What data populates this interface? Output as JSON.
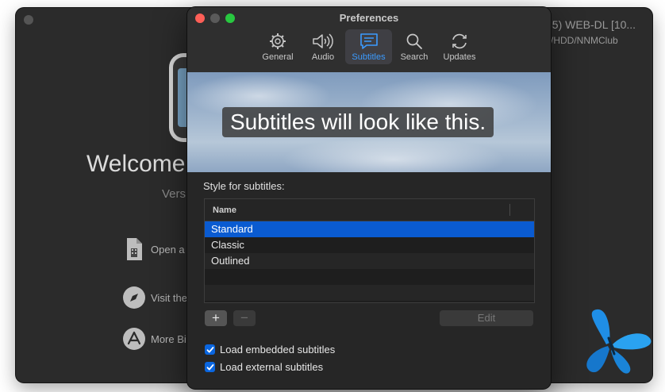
{
  "background_window": {
    "welcome_title": "Welcome",
    "version_label": "Vers",
    "items": [
      {
        "icon": "document-icon",
        "label": "Open a"
      },
      {
        "icon": "compass-icon",
        "label": "Visit the"
      },
      {
        "icon": "app-store-icon",
        "label": "More Bi"
      }
    ],
    "recent": {
      "line1": "35) WEB-DL [10...",
      "line2": "s/HDD/NNMClub"
    }
  },
  "preferences": {
    "title": "Preferences",
    "tabs": [
      {
        "icon": "gear-icon",
        "label": "General"
      },
      {
        "icon": "speaker-icon",
        "label": "Audio"
      },
      {
        "icon": "subtitles-icon",
        "label": "Subtitles",
        "active": true
      },
      {
        "icon": "search-icon",
        "label": "Search"
      },
      {
        "icon": "refresh-icon",
        "label": "Updates"
      }
    ],
    "preview_text": "Subtitles will look like this.",
    "style_label": "Style for subtitles:",
    "table": {
      "column_header": "Name",
      "rows": [
        "Standard",
        "Classic",
        "Outlined"
      ],
      "selected": "Standard"
    },
    "buttons": {
      "add": "+",
      "remove": "−",
      "edit": "Edit"
    },
    "checkboxes": [
      {
        "label": "Load embedded subtitles",
        "checked": true
      },
      {
        "label": "Load external subtitles",
        "checked": true
      }
    ]
  },
  "colors": {
    "accent": "#0a5bd1",
    "tab_active": "#3b9bff"
  }
}
